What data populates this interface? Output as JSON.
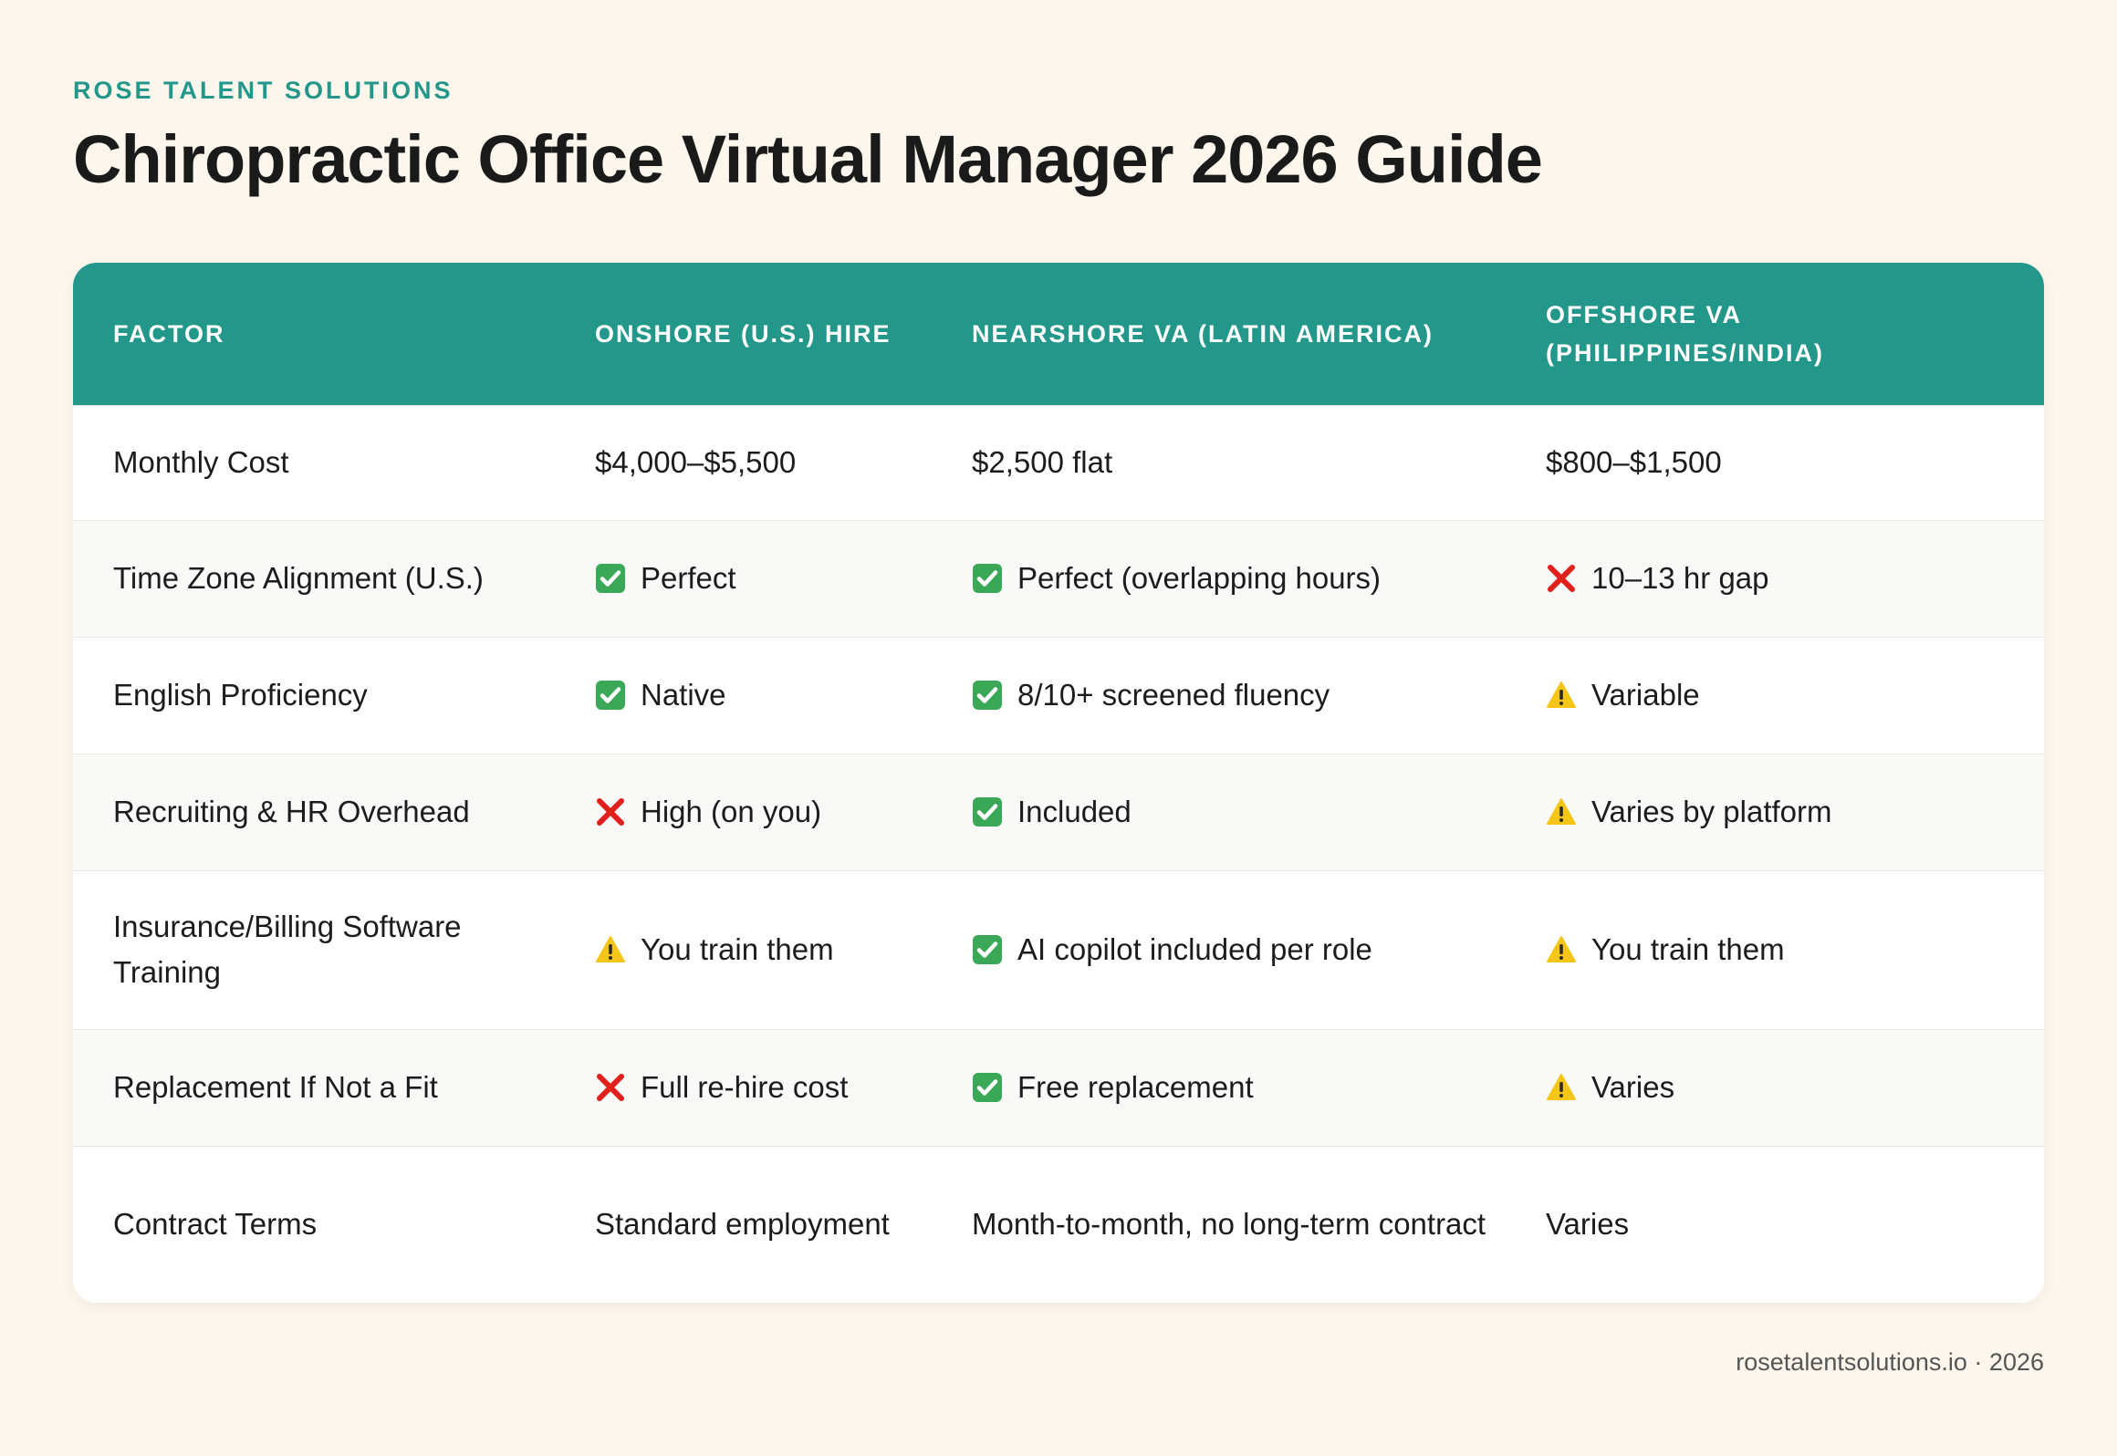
{
  "header": {
    "brand": "ROSE TALENT SOLUTIONS",
    "title": "Chiropractic Office Virtual Manager 2026 Guide"
  },
  "table": {
    "columns": [
      "FACTOR",
      "ONSHORE (U.S.) HIRE",
      "NEARSHORE VA (LATIN AMERICA)",
      "OFFSHORE VA (PHILIPPINES/INDIA)"
    ],
    "rows": [
      {
        "factor": "Monthly Cost",
        "cells": [
          {
            "icon": "",
            "text": "$4,000–$5,500"
          },
          {
            "icon": "",
            "text": "$2,500 flat"
          },
          {
            "icon": "",
            "text": "$800–$1,500"
          }
        ]
      },
      {
        "factor": "Time Zone Alignment (U.S.)",
        "cells": [
          {
            "icon": "check-icon",
            "text": "Perfect"
          },
          {
            "icon": "check-icon",
            "text": "Perfect (overlapping hours)"
          },
          {
            "icon": "cross-icon",
            "text": "10–13 hr gap"
          }
        ]
      },
      {
        "factor": "English Proficiency",
        "cells": [
          {
            "icon": "check-icon",
            "text": "Native"
          },
          {
            "icon": "check-icon",
            "text": "8/10+ screened fluency"
          },
          {
            "icon": "warning-icon",
            "text": "Variable"
          }
        ]
      },
      {
        "factor": "Recruiting & HR Overhead",
        "cells": [
          {
            "icon": "cross-icon",
            "text": "High (on you)"
          },
          {
            "icon": "check-icon",
            "text": "Included"
          },
          {
            "icon": "warning-icon",
            "text": "Varies by platform"
          }
        ]
      },
      {
        "factor": "Insurance/Billing Software Training",
        "cells": [
          {
            "icon": "warning-icon",
            "text": "You train them"
          },
          {
            "icon": "check-icon",
            "text": "AI copilot included per role"
          },
          {
            "icon": "warning-icon",
            "text": "You train them"
          }
        ]
      },
      {
        "factor": "Replacement If Not a Fit",
        "cells": [
          {
            "icon": "cross-icon",
            "text": "Full re-hire cost"
          },
          {
            "icon": "check-icon",
            "text": "Free replacement"
          },
          {
            "icon": "warning-icon",
            "text": "Varies"
          }
        ]
      },
      {
        "factor": "Contract Terms",
        "cells": [
          {
            "icon": "",
            "text": "Standard employment"
          },
          {
            "icon": "",
            "text": "Month-to-month, no long-term contract"
          },
          {
            "icon": "",
            "text": "Varies"
          }
        ]
      }
    ]
  },
  "footer": {
    "text": "rosetalentsolutions.io · 2026"
  },
  "colors": {
    "accent": "#23978a",
    "background": "#fdf6ec",
    "check": "#3aa857",
    "cross": "#e0201b",
    "warning": "#f5c518"
  }
}
